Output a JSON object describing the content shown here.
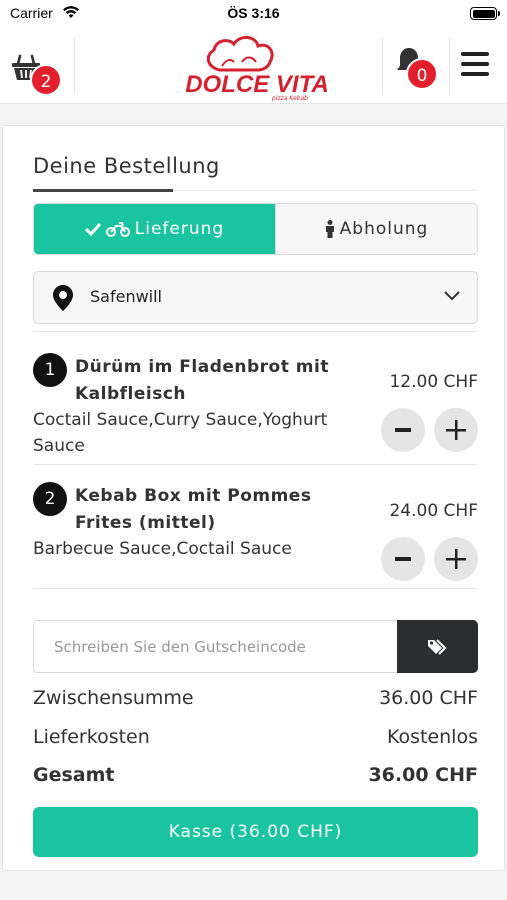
{
  "status_bar": {
    "carrier": "Carrier",
    "time": "ÖS 3:16"
  },
  "header": {
    "cart_count": "2",
    "notification_count": "0",
    "logo_text": "DOLCE VITA",
    "logo_subtext": "pizza Kebab"
  },
  "order": {
    "title": "Deine Bestellung",
    "delivery_tab": "Lieferung",
    "pickup_tab": "Abholung",
    "location": "Safenwill",
    "items": [
      {
        "index": "1",
        "name": "Dürüm im Fladenbrot mit Kalbfleisch",
        "sauces": "Coctail Sauce,Curry Sauce,Yoghurt Sauce",
        "price": "12.00 CHF"
      },
      {
        "index": "2",
        "name": "Kebab Box mit Pommes Frites (mittel)",
        "sauces": "Barbecue Sauce,Coctail Sauce",
        "price": "24.00 CHF"
      }
    ],
    "coupon_placeholder": "Schreiben Sie den Gutscheincode",
    "subtotal_label": "Zwischensumme",
    "subtotal_value": "36.00 CHF",
    "delivery_label": "Lieferkosten",
    "delivery_value": "Kostenlos",
    "total_label": "Gesamt",
    "total_value": "36.00 CHF",
    "checkout_label": "Kasse (36.00 CHF)"
  },
  "colors": {
    "accent": "#1ac4a0",
    "badge": "#e41f2d",
    "dark": "#2b2d2e",
    "logo_red": "#d5212e"
  }
}
